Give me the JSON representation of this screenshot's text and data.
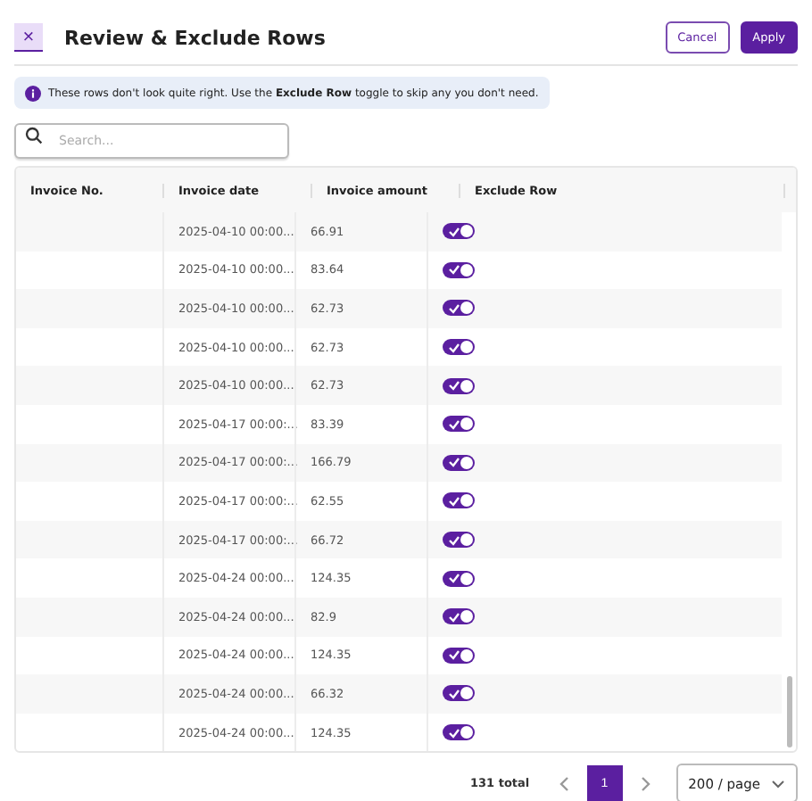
{
  "header": {
    "close": "×",
    "title": "Review & Exclude Rows",
    "buttons": [
      {
        "label": "Cancel",
        "kind": "secondary"
      },
      {
        "label": "Apply",
        "kind": "primary"
      }
    ]
  },
  "notice": "These rows don't look quite right. Use the **Exclude Row** toggle to skip any you don't need.",
  "search": {
    "placeholder": "Search..."
  },
  "table": {
    "columns": [
      "Invoice No.",
      "Invoice date",
      "Invoice amount",
      "Exclude Row"
    ],
    "rows": [
      {
        "date": "2025-04-10 00:00...",
        "amount": "66.91",
        "exclude": true
      },
      {
        "date": "2025-04-10 00:00...",
        "amount": "83.64",
        "exclude": true
      },
      {
        "date": "2025-04-10 00:00...",
        "amount": "62.73",
        "exclude": true
      },
      {
        "date": "2025-04-10 00:00...",
        "amount": "62.73",
        "exclude": true
      },
      {
        "date": "2025-04-10 00:00...",
        "amount": "62.73",
        "exclude": true
      },
      {
        "date": "2025-04-17 00:00:...",
        "amount": "83.39",
        "exclude": true
      },
      {
        "date": "2025-04-17 00:00:...",
        "amount": "166.79",
        "exclude": true
      },
      {
        "date": "2025-04-17 00:00:...",
        "amount": "62.55",
        "exclude": true
      },
      {
        "date": "2025-04-17 00:00:...",
        "amount": "66.72",
        "exclude": true
      },
      {
        "date": "2025-04-24 00:00...",
        "amount": "124.35",
        "exclude": true
      },
      {
        "date": "2025-04-24 00:00...",
        "amount": "82.9",
        "exclude": true
      },
      {
        "date": "2025-04-24 00:00...",
        "amount": "124.35",
        "exclude": true
      },
      {
        "date": "2025-04-24 00:00...",
        "amount": "66.32",
        "exclude": true
      },
      {
        "date": "2025-04-24 00:00...",
        "amount": "124.35",
        "exclude": true
      }
    ]
  },
  "pagination": {
    "total": "131 total",
    "pages": [
      {
        "label": "1",
        "selected": true
      }
    ],
    "page_size": "200 / page"
  }
}
